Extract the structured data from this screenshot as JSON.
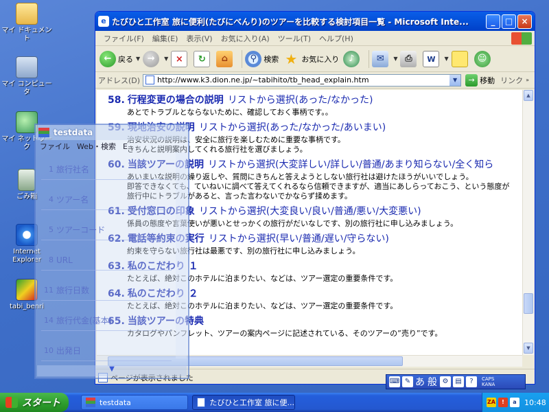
{
  "desktop_icons": [
    {
      "label": "マイ ドキュメント",
      "glyph": "folder-icon"
    },
    {
      "label": "マイ コンピュータ",
      "glyph": "computer-icon"
    },
    {
      "label": "マイ ネットワーク",
      "glyph": "network-icon"
    },
    {
      "label": "ごみ箱",
      "glyph": "recycle-bin-icon"
    },
    {
      "label": "Internet Explorer",
      "glyph": "ie-icon"
    },
    {
      "label": "tabi_benri",
      "glyph": "shortcut-icon"
    }
  ],
  "ie": {
    "title": "たびひと工作室 旅に便利(たびにべんり)のツアーを比較する検討項目一覧 - Microsoft Inte...",
    "menu": [
      "ファイル(F)",
      "編集(E)",
      "表示(V)",
      "お気に入り(A)",
      "ツール(T)",
      "ヘルプ(H)"
    ],
    "toolbar": {
      "back": "戻る",
      "search": "検索",
      "favorites": "お気に入り"
    },
    "address_label": "アドレス(D)",
    "address_value": "http://www.k3.dion.ne.jp/~tabihito/tb_head_explain.htm",
    "go_label": "移動",
    "links_label": "リンク",
    "status": "ページが表示されました"
  },
  "items": [
    {
      "num": "58.",
      "title": "行程変更の場合の説明",
      "option": "リストから選択(あった/なかった)",
      "desc": [
        "あとでトラブルとならないために、確認しておく事柄です。。"
      ]
    },
    {
      "num": "59.",
      "title": "現地治安の説明",
      "option": "リストから選択(あった/なかった/あいまい)",
      "desc": [
        "治安状況の説明は、安全に旅行を楽しむために重要な事柄です。",
        "きちんと説明案内してくれる旅行社を選びましょう。"
      ]
    },
    {
      "num": "60.",
      "title": "当該ツアーの説明",
      "option": "リストから選択(大変詳しい/詳しい/普通/あまり知らない/全く知ら",
      "desc": [
        "あいまいな説明の繰り返しや、質問にきちんと答えようとしない旅行社は避けたほうがいいでしょう。",
        "即答できなくても、ていねいに調べて答えてくれるなら信頼できますが、適当にあしらっておこう、という態度が",
        "旅行中にトラブルがあると、言った言わないでかならず揉めます。"
      ]
    },
    {
      "num": "61.",
      "title": "受付窓口の印象",
      "option": "リストから選択(大変良い/良い/普通/悪い/大変悪い)",
      "desc": [
        "係員の態度や言葉使いが悪いとせっかくの旅行がだいなしです、別の旅行社に申し込みましょう。"
      ]
    },
    {
      "num": "62.",
      "title": "電話等約束の実行",
      "option": "リストから選択(早い/普通/遅い/守らない)",
      "desc": [
        "約束を守らない旅行社は最悪です、別の旅行社に申し込みましょう。"
      ]
    },
    {
      "num": "63.",
      "title": "私のこだわり １",
      "option": "",
      "desc": [
        "たとえば、絶対このホテルに泊まりたい、などは、ツアー選定の重要条件です。"
      ]
    },
    {
      "num": "64.",
      "title": "私のこだわり ２",
      "option": "",
      "desc": [
        "たとえば、絶対このホテルに泊まりたい、などは、ツアー選定の重要条件です。"
      ]
    },
    {
      "num": "65.",
      "title": "当該ツアーの特典",
      "option": "",
      "desc": [
        "カタログやパンフレット、ツアーの案内ページに記述されている、そのツアーの”売り”です。"
      ]
    }
  ],
  "float_window": {
    "title": "testdata",
    "menu": [
      "ファイル",
      "Web・検索",
      "E"
    ],
    "fields": [
      {
        "num": "1",
        "label": "旅行社名"
      },
      {
        "num": "4",
        "label": "ツアー名"
      },
      {
        "num": "5",
        "label": "ツアーコード"
      },
      {
        "num": "8",
        "label": "URL"
      },
      {
        "num": "11",
        "label": "旅行日数"
      },
      {
        "num": "14",
        "label": "旅行代金(基本)"
      },
      {
        "num": "10",
        "label": "出発日"
      }
    ]
  },
  "ime": {
    "mode": "あ",
    "dict": "般",
    "caps1": "CAPS",
    "caps2": "KANA"
  },
  "taskbar": {
    "start": "スタート",
    "tasks": [
      "testdata",
      "たびひと工作室 旅に便..."
    ],
    "clock": "10:48"
  }
}
